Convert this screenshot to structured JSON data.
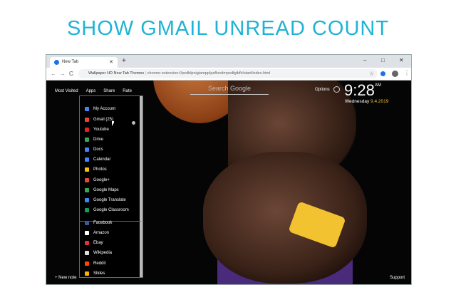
{
  "headline": "SHOW GMAIL UNREAD COUNT",
  "browser": {
    "tab_title": "New Tab",
    "new_tab": "+",
    "minimize": "–",
    "maximize": "□",
    "close": "✕",
    "back": "←",
    "forward": "→",
    "reload": "C",
    "site_label": "Wallpaper HD New Tab Themes",
    "separator": "|",
    "url": "chrome-extension://pedblpnigiampp/pafloedmpedfgibfh/start/index.html",
    "star": "☆"
  },
  "nav": {
    "most_visited": "Most Visited",
    "apps": "Apps",
    "share": "Share",
    "rate": "Rate"
  },
  "search_placeholder": "Search Google",
  "options": "Options",
  "clock": {
    "time": "9:28",
    "ampm": "AM",
    "weekday": "Wednesday",
    "date": "9.4.2019"
  },
  "apps": [
    {
      "label": "My Account",
      "color": "#4285f4"
    },
    {
      "label": "Gmail (25)",
      "color": "#ea4335"
    },
    {
      "label": "Youtube",
      "color": "#e62117"
    },
    {
      "label": "Drive",
      "color": "#34a853"
    },
    {
      "label": "Docs",
      "color": "#4285f4"
    },
    {
      "label": "Calendar",
      "color": "#4285f4"
    },
    {
      "label": "Photos",
      "color": "#fbbc05"
    },
    {
      "label": "Google+",
      "color": "#dd4b39"
    },
    {
      "label": "Google Maps",
      "color": "#34a853"
    },
    {
      "label": "Google Translate",
      "color": "#4285f4"
    },
    {
      "label": "Google Classroom",
      "color": "#0f9d58"
    },
    {
      "label": "Facebook",
      "color": "#3b5998"
    },
    {
      "label": "Amazon",
      "color": "#ffffff"
    },
    {
      "label": "Ebay",
      "color": "#e53238"
    },
    {
      "label": "Wikipedia",
      "color": "#dddddd"
    },
    {
      "label": "Reddit",
      "color": "#ff4500"
    },
    {
      "label": "Slides",
      "color": "#f4b400"
    }
  ],
  "new_note": "+ New note",
  "support": "Support"
}
